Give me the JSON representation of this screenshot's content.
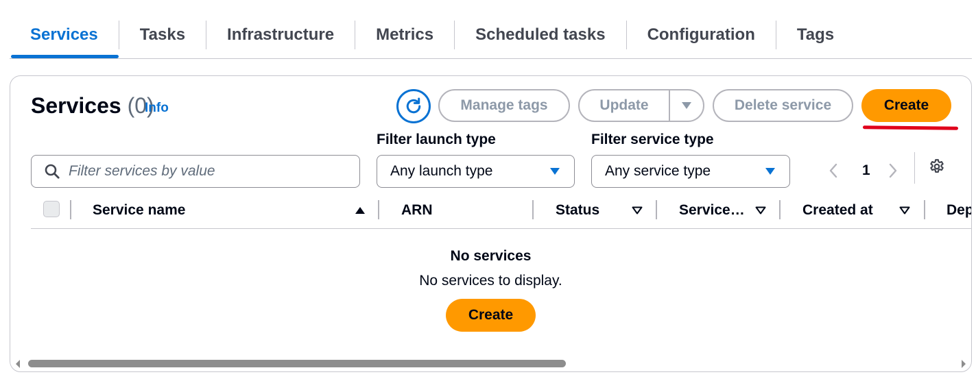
{
  "tabs": [
    {
      "label": "Services",
      "active": true
    },
    {
      "label": "Tasks"
    },
    {
      "label": "Infrastructure"
    },
    {
      "label": "Metrics"
    },
    {
      "label": "Scheduled tasks"
    },
    {
      "label": "Configuration"
    },
    {
      "label": "Tags"
    }
  ],
  "header": {
    "title": "Services",
    "count": "(0)",
    "info": "Info"
  },
  "actions": {
    "refresh_icon": "refresh-icon",
    "manage_tags": "Manage tags",
    "update": "Update",
    "delete_service": "Delete service",
    "create": "Create",
    "create_highlight_color": "#e0001b"
  },
  "filters": {
    "search_placeholder": "Filter services by value",
    "launch_type_label": "Filter launch type",
    "launch_type_value": "Any launch type",
    "service_type_label": "Filter service type",
    "service_type_value": "Any service type"
  },
  "pagination": {
    "current_page": "1"
  },
  "table": {
    "columns": [
      "Service name",
      "ARN",
      "Status",
      "Service…",
      "Created at",
      "Dep"
    ]
  },
  "empty": {
    "title": "No services",
    "message": "No services to display.",
    "create": "Create"
  },
  "colors": {
    "accent": "#0972d3",
    "primary_button": "#ff9900",
    "disabled_text": "#8d99a8"
  }
}
